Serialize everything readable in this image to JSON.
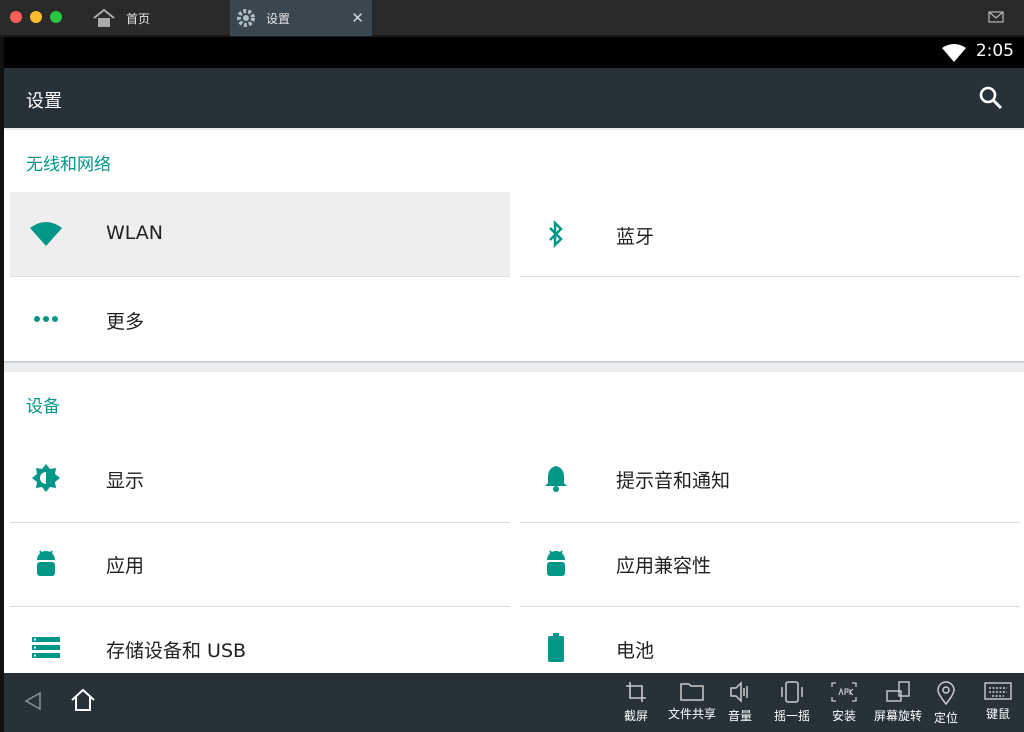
{
  "window": {
    "tabs": [
      {
        "label": "首页"
      },
      {
        "label": "设置"
      }
    ],
    "close_glyph": "✕"
  },
  "status_bar": {
    "time": "2:05"
  },
  "app_bar": {
    "title": "设置"
  },
  "sections": [
    {
      "title": "无线和网络",
      "items": [
        {
          "label": "WLAN",
          "icon": "wifi-icon"
        },
        {
          "label": "蓝牙",
          "icon": "bluetooth-icon"
        },
        {
          "label": "更多",
          "icon": "more-icon"
        }
      ]
    },
    {
      "title": "设备",
      "items": [
        {
          "label": "显示",
          "icon": "brightness-icon"
        },
        {
          "label": "提示音和通知",
          "icon": "bell-icon"
        },
        {
          "label": "应用",
          "icon": "android-icon"
        },
        {
          "label": "应用兼容性",
          "icon": "android-icon"
        },
        {
          "label": "存储设备和 USB",
          "icon": "storage-icon"
        },
        {
          "label": "电池",
          "icon": "battery-icon"
        }
      ]
    }
  ],
  "toolbar": {
    "items": [
      {
        "label": "截屏",
        "icon": "crop-icon"
      },
      {
        "label": "文件共享",
        "icon": "folder-icon"
      },
      {
        "label": "音量",
        "icon": "volume-icon"
      },
      {
        "label": "摇一摇",
        "icon": "shake-icon"
      },
      {
        "label": "安装",
        "icon": "apk-icon"
      },
      {
        "label": "屏幕旋转",
        "icon": "rotate-icon"
      },
      {
        "label": "定位",
        "icon": "location-icon"
      },
      {
        "label": "键鼠",
        "icon": "keyboard-icon"
      }
    ]
  },
  "colors": {
    "accent": "#009688",
    "app_bar": "#263238",
    "selected_item": "#eeeeee"
  }
}
